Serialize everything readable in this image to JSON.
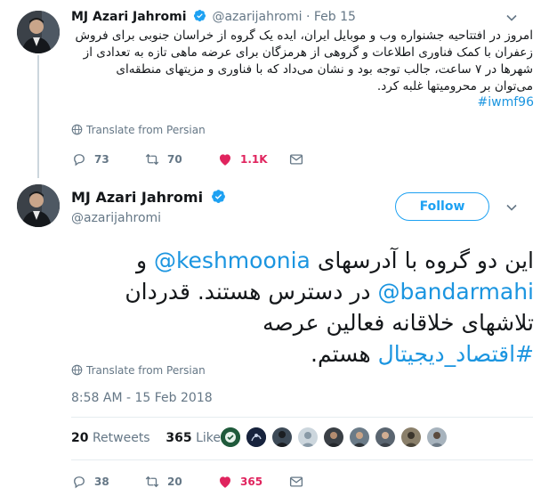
{
  "tweet1": {
    "author_name": "MJ Azari Jahromi",
    "handle": "@azarijahromi",
    "separator": "·",
    "date": "Feb 15",
    "text_lines": [
      "امروز در افتتاحیه جشنواره وب و موبایل ایران، ایده یک گروه از خراسان جنوبی برای فروش",
      "زعفران با کمک فناوری اطلاعات و گروهی از هرمزگان برای عرضه ماهی تازه به تعدادی از",
      "شهرها در ۷ ساعت، جالب توجه بود و نشان می‌داد که با فناوری و مزیتهای منطقه‌ای",
      "می‌توان بر محرومیتها غلبه کرد."
    ],
    "hashtag": "#iwmf96",
    "translate_label": "Translate from Persian",
    "replies": "73",
    "retweets": "70",
    "likes": "1.1K"
  },
  "tweet2": {
    "author_name": "MJ Azari Jahromi",
    "handle": "@azarijahromi",
    "follow_label": "Follow",
    "text": {
      "l1_pre": "این دو گروه با آدرسهای ",
      "mention1": "@keshmoonia",
      "l1_post": " و",
      "mention2": "@bandarmahi",
      "l2_post": " در دسترس هستند. قدردان",
      "l3": "تلاشهای خلاقانه فعالین عرصه",
      "hashtag": "#اقتصاد_دیجیتال",
      "l4_post": " هستم."
    },
    "translate_label": "Translate from Persian",
    "timestamp": "8:58 AM - 15 Feb 2018",
    "retweet_count": "20",
    "retweet_label": "Retweets",
    "like_count": "365",
    "like_label": "Likes",
    "replies": "38",
    "retweets": "20",
    "likes": "365"
  },
  "colors": {
    "accent": "#1da1f2",
    "link": "#1b95e0",
    "like": "#e0245e",
    "muted": "#657786",
    "border": "#e6ecf0"
  },
  "icons": [
    "verified-badge-icon",
    "chevron-down-icon",
    "globe-icon",
    "reply-icon",
    "retweet-icon",
    "heart-icon",
    "message-icon"
  ]
}
